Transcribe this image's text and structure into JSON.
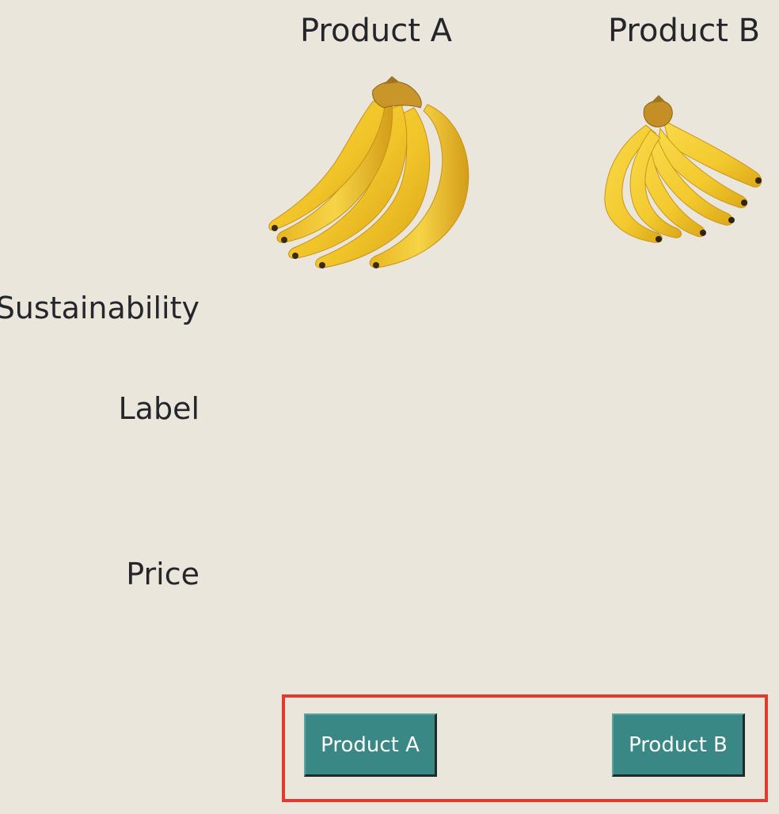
{
  "columns": {
    "product_a_header": "Product A",
    "product_b_header": "Product B"
  },
  "images": {
    "product_a": "banana-bunch-large",
    "product_b": "banana-bunch-small"
  },
  "rows": {
    "sustainability": "Sustainability",
    "label": "Label",
    "price": "Price"
  },
  "choice": {
    "button_a": "Product A",
    "button_b": "Product B",
    "highlight_color": "#e23a2c",
    "button_color": "#3a8886"
  }
}
